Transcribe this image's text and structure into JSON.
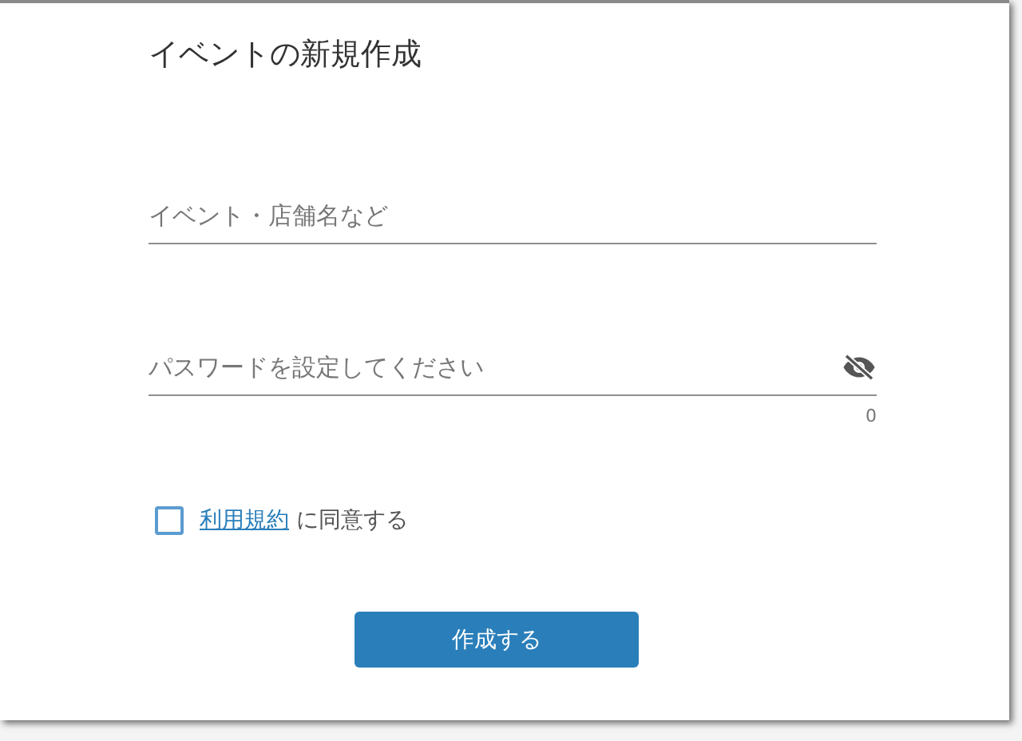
{
  "title": "イベントの新規作成",
  "fields": [
    {
      "placeholder": "イベント・店舗名など",
      "kind": "text"
    },
    {
      "placeholder": "パスワードを設定してください",
      "kind": "password",
      "counter": "0"
    }
  ],
  "terms": {
    "checked": false,
    "link": "利用規約",
    "text": "に同意する"
  },
  "submit": "作成する"
}
